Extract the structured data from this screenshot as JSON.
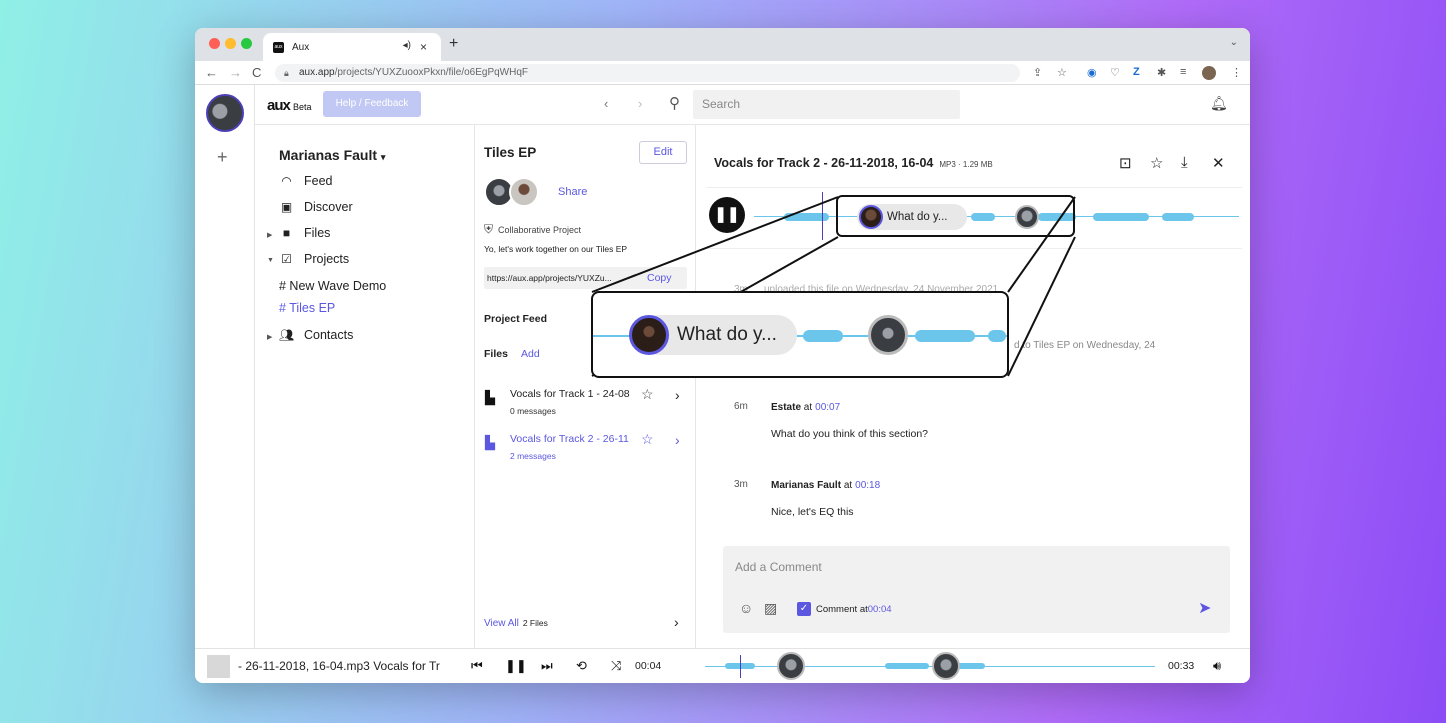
{
  "browser": {
    "tab_title": "Aux",
    "favicon_text": "aux",
    "url_domain": "aux.app",
    "url_path": "/projects/YUXZuooxPkxn/file/o6EgPqWHqF"
  },
  "app": {
    "logo": "aux",
    "logo_badge": "Beta",
    "help_button": "Help / Feedback",
    "search_placeholder": "Search"
  },
  "sidebar": {
    "workspace": "Marianas Fault",
    "items": [
      {
        "label": "Feed",
        "icon": "rss-icon"
      },
      {
        "label": "Discover",
        "icon": "discover-icon"
      },
      {
        "label": "Files",
        "icon": "folder-icon"
      },
      {
        "label": "Projects",
        "icon": "project-icon"
      },
      {
        "label": "Contacts",
        "icon": "contacts-icon"
      }
    ],
    "projects": [
      "# New Wave Demo",
      "# Tiles EP"
    ]
  },
  "project": {
    "title": "Tiles EP",
    "edit": "Edit",
    "share": "Share",
    "type": "Collaborative Project",
    "description": "Yo, let's work together on our Tiles EP",
    "link": "https://aux.app/projects/YUXZu...",
    "copy": "Copy",
    "feed_heading": "Project Feed",
    "files_heading": "Files",
    "add": "Add",
    "files": [
      {
        "name": "Vocals for Track 1 - 24-08",
        "messages": "0 messages"
      },
      {
        "name": "Vocals for Track 2 - 26-11",
        "messages": "2 messages"
      }
    ],
    "view_all": "View All",
    "file_count": "2 Files"
  },
  "file": {
    "title": "Vocals for Track 2 - 26-11-2018, 16-04",
    "meta": "MP3 · 1.29 MB",
    "bubble_text": "What do y...",
    "zoom_text": "What do y...",
    "activity1_time": "3m",
    "activity1": "uploaded this file on Wednesday, 24 November 2021",
    "activity2": "d to Tiles EP on Wednesday, 24",
    "comments": [
      {
        "age": "6m",
        "author": "Estate",
        "at": "at",
        "time": "00:07",
        "text": "What do you think of this section?"
      },
      {
        "age": "3m",
        "author": "Marianas Fault",
        "at": "at",
        "time": "00:18",
        "text": "Nice, let's EQ this"
      }
    ],
    "comment_placeholder": "Add a Comment",
    "comment_at_label": "Comment at",
    "comment_at_time": "00:04"
  },
  "player": {
    "track": "- 26-11-2018, 16-04.mp3   Vocals for Tr",
    "current": "00:04",
    "duration": "00:33"
  },
  "colors": {
    "accent": "#5b57e0",
    "wave": "#6cc6ec"
  }
}
